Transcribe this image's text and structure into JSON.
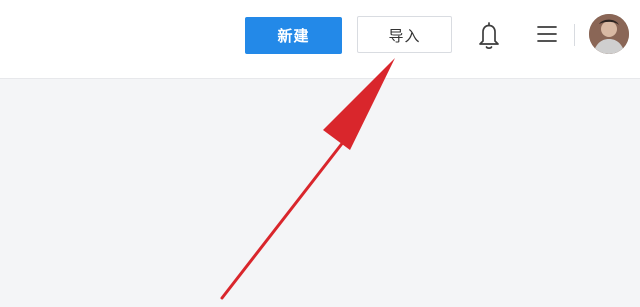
{
  "header": {
    "new_button_label": "新建",
    "import_button_label": "导入",
    "icons": {
      "notification": "bell-icon",
      "menu": "menu-icon",
      "avatar": "user-avatar"
    }
  },
  "colors": {
    "primary": "#2389e8",
    "annotation_arrow": "#d9262c",
    "page_background": "#f4f5f7"
  }
}
